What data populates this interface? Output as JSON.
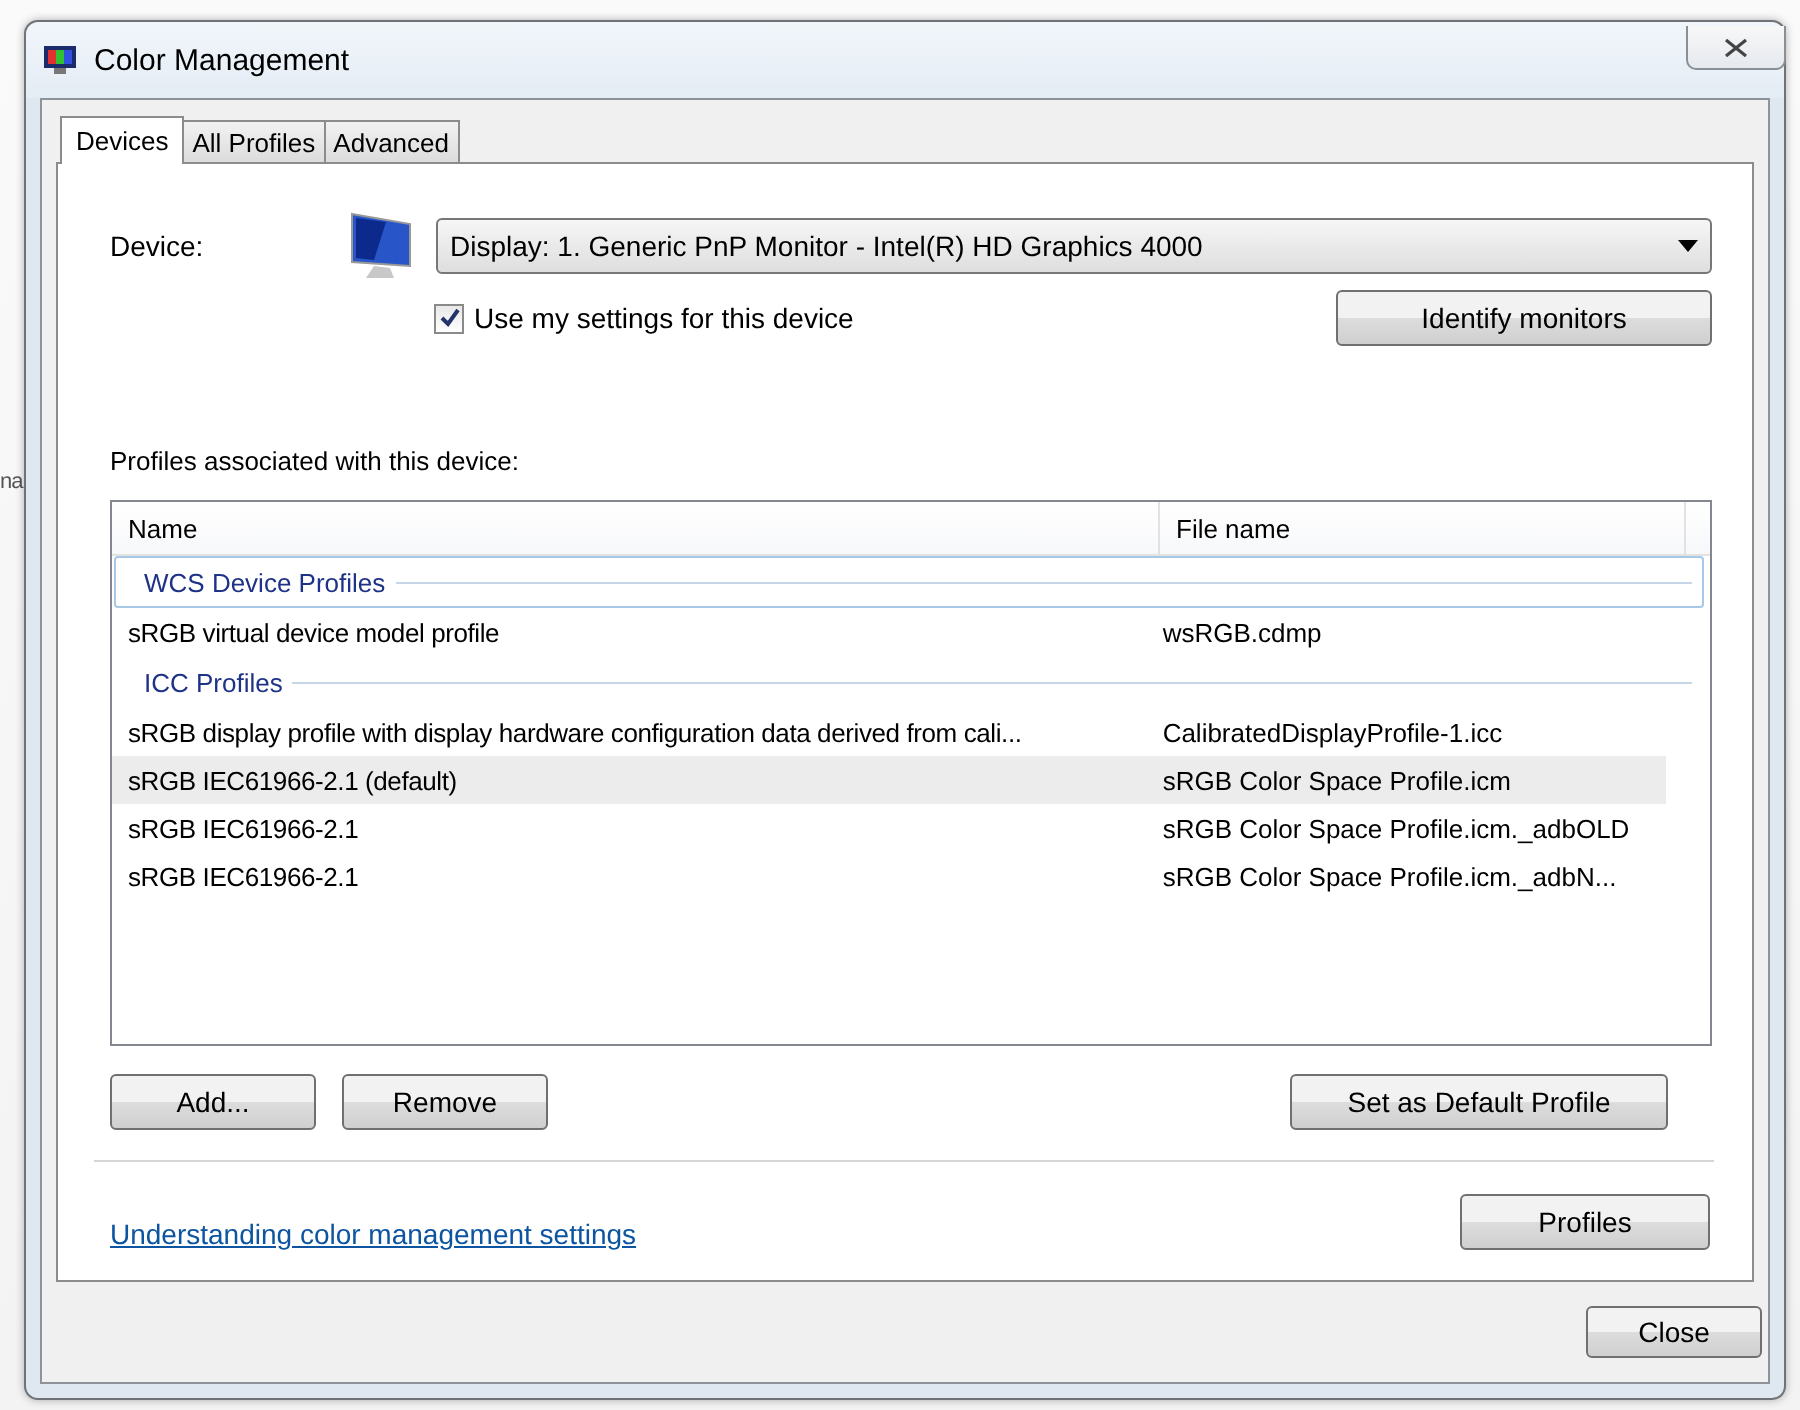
{
  "background_text": "na",
  "window": {
    "title": "Color Management"
  },
  "tabs": [
    {
      "label": "Devices",
      "selected": true
    },
    {
      "label": "All Profiles",
      "selected": false
    },
    {
      "label": "Advanced",
      "selected": false
    }
  ],
  "device": {
    "label": "Device:",
    "value": "Display: 1. Generic PnP Monitor - Intel(R) HD Graphics 4000"
  },
  "use_my_settings": {
    "label": "Use my settings for this device",
    "checked": true
  },
  "identify_button": "Identify monitors",
  "profiles_label": "Profiles associated with this device:",
  "table": {
    "columns": [
      "Name",
      "File name"
    ],
    "rows": [
      {
        "kind": "group",
        "label": "WCS Device Profiles",
        "focused": true
      },
      {
        "kind": "item",
        "name": "sRGB virtual device model profile",
        "file": "wsRGB.cdmp",
        "selected": false
      },
      {
        "kind": "group",
        "label": "ICC Profiles",
        "focused": false
      },
      {
        "kind": "item",
        "name": "sRGB display profile with display hardware configuration data derived from cali...",
        "file": "CalibratedDisplayProfile-1.icc",
        "selected": false
      },
      {
        "kind": "item",
        "name": "sRGB IEC61966-2.1 (default)",
        "file": "sRGB Color Space Profile.icm",
        "selected": true
      },
      {
        "kind": "item",
        "name": "sRGB IEC61966-2.1",
        "file": "sRGB Color Space Profile.icm._adbOLD",
        "selected": false
      },
      {
        "kind": "item",
        "name": "sRGB IEC61966-2.1",
        "file": "sRGB Color Space Profile.icm._adbN...",
        "selected": false
      }
    ]
  },
  "list_buttons": {
    "left": [
      "Add...",
      "Remove"
    ],
    "right": [
      "Set as Default Profile"
    ]
  },
  "link": "Understanding color management settings",
  "profiles_button": "Profiles",
  "close_button": "Close"
}
